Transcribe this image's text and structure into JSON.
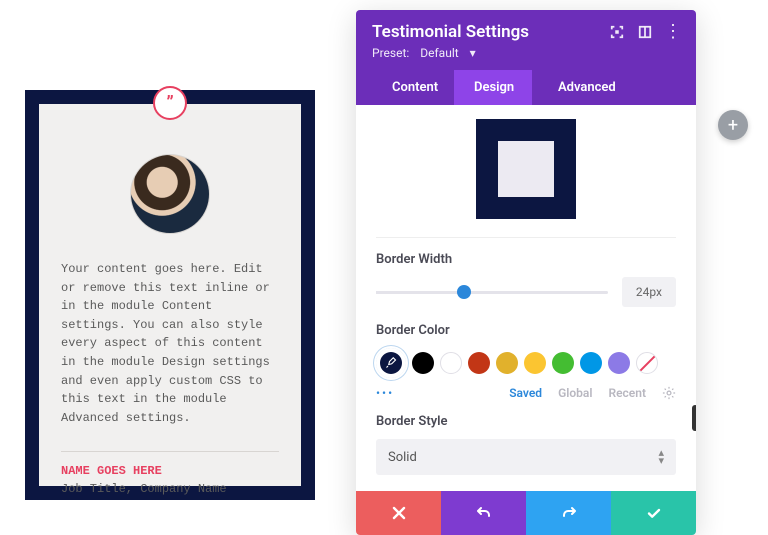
{
  "testimonial": {
    "content": "Your content goes here. Edit or remove this text inline or in the module Content settings. You can also style every aspect of this content in the module Design settings and even apply custom CSS to this text in the module Advanced settings.",
    "name": "NAME GOES HERE",
    "job": "Job Title, Company Name",
    "quote_glyph": "”"
  },
  "panel": {
    "title": "Testimonial Settings",
    "preset_label": "Preset:",
    "preset_value": "Default",
    "tabs": {
      "content": "Content",
      "design": "Design",
      "advanced": "Advanced",
      "active": "design"
    },
    "border_width": {
      "label": "Border Width",
      "value": "24px",
      "percent": 38
    },
    "border_color": {
      "label": "Border Color",
      "swatches": [
        "#0b1640",
        "#000000",
        "#ffffff",
        "#c23616",
        "#e1b12c",
        "#fbc531",
        "#44bd32",
        "#0097e6",
        "#8c7ae6"
      ],
      "selected_index": 0,
      "tabs": {
        "saved": "Saved",
        "global": "Global",
        "recent": "Recent",
        "active": "saved"
      }
    },
    "border_style": {
      "label": "Border Style",
      "value": "Solid"
    }
  },
  "fab": {
    "glyph": "+"
  }
}
